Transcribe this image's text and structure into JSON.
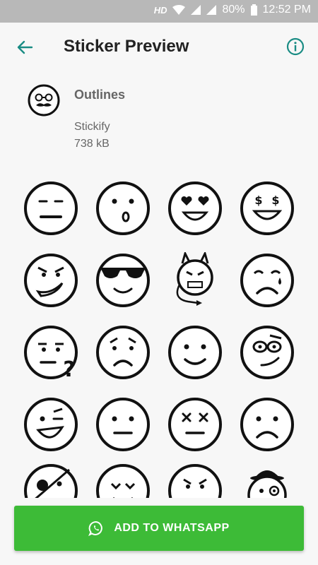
{
  "status_bar": {
    "network": "HD",
    "battery": "80%",
    "time": "12:52 PM"
  },
  "toolbar": {
    "title": "Sticker Preview"
  },
  "pack": {
    "name": "Outlines",
    "publisher": "Stickify",
    "size": "738 kB"
  },
  "stickers": [
    "neutral-face",
    "surprised-face",
    "heart-eyes-face",
    "money-eyes-face",
    "smirk-face",
    "sunglasses-face",
    "devil-face",
    "crying-face",
    "confused-face",
    "worried-face",
    "smiling-face",
    "nerd-face",
    "winking-face",
    "expressionless-face",
    "dizzy-face",
    "sad-face",
    "pirate-face",
    "smile-face",
    "angry-face",
    "monocle-face"
  ],
  "cta": {
    "label": "ADD TO WHATSAPP",
    "icon": "whatsapp-icon"
  },
  "colors": {
    "accent": "#1a8c84",
    "button": "#3dbb37"
  }
}
